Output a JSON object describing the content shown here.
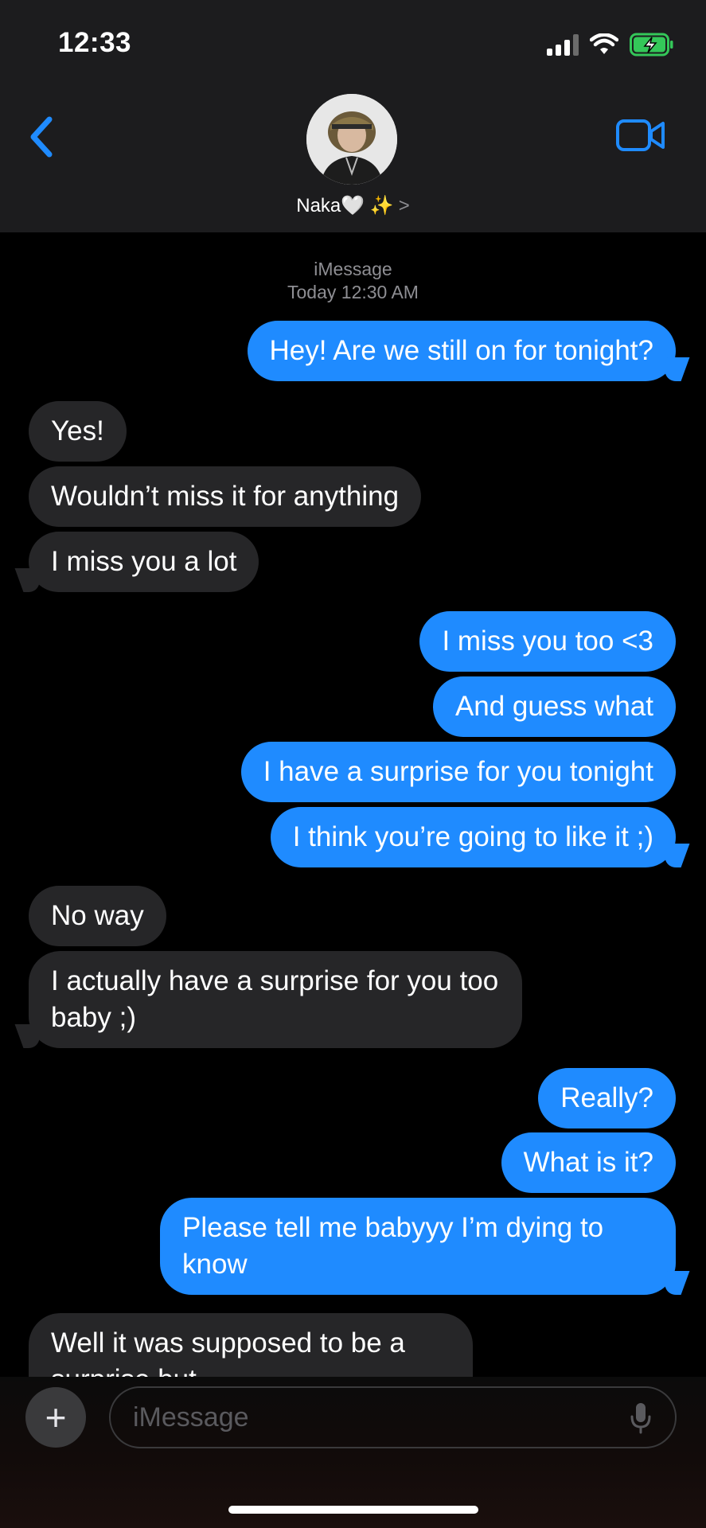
{
  "status_bar": {
    "time": "12:33"
  },
  "header": {
    "contact_name": "Naka🤍 ✨",
    "chevron": ">"
  },
  "thread": {
    "service": "iMessage",
    "timestamp": "Today 12:30 AM"
  },
  "messages": [
    {
      "from": "me",
      "text": "Hey! Are we still on for tonight?"
    },
    {
      "from": "them",
      "text": "Yes!"
    },
    {
      "from": "them",
      "text": "Wouldn’t miss it for anything"
    },
    {
      "from": "them",
      "text": "I miss you a lot"
    },
    {
      "from": "me",
      "text": "I miss you too <3"
    },
    {
      "from": "me",
      "text": "And guess what"
    },
    {
      "from": "me",
      "text": "I have a surprise for you tonight"
    },
    {
      "from": "me",
      "text": "I think you’re going to like it ;)"
    },
    {
      "from": "them",
      "text": "No way"
    },
    {
      "from": "them",
      "text": "I actually have a surprise for you too baby ;)"
    },
    {
      "from": "me",
      "text": "Really?"
    },
    {
      "from": "me",
      "text": "What is it?"
    },
    {
      "from": "me",
      "text": "Please tell me babyyy I’m dying to know"
    },
    {
      "from": "them",
      "text": "Well it was supposed to be a surprise but"
    }
  ],
  "composer": {
    "plus": "+",
    "placeholder": "iMessage"
  },
  "colors": {
    "accent": "#1f8bff",
    "incoming": "#262628",
    "battery": "#34c759"
  },
  "icons": [
    "back-chevron-icon",
    "video-call-icon",
    "signal-icon",
    "wifi-icon",
    "battery-charging-icon",
    "microphone-icon"
  ]
}
